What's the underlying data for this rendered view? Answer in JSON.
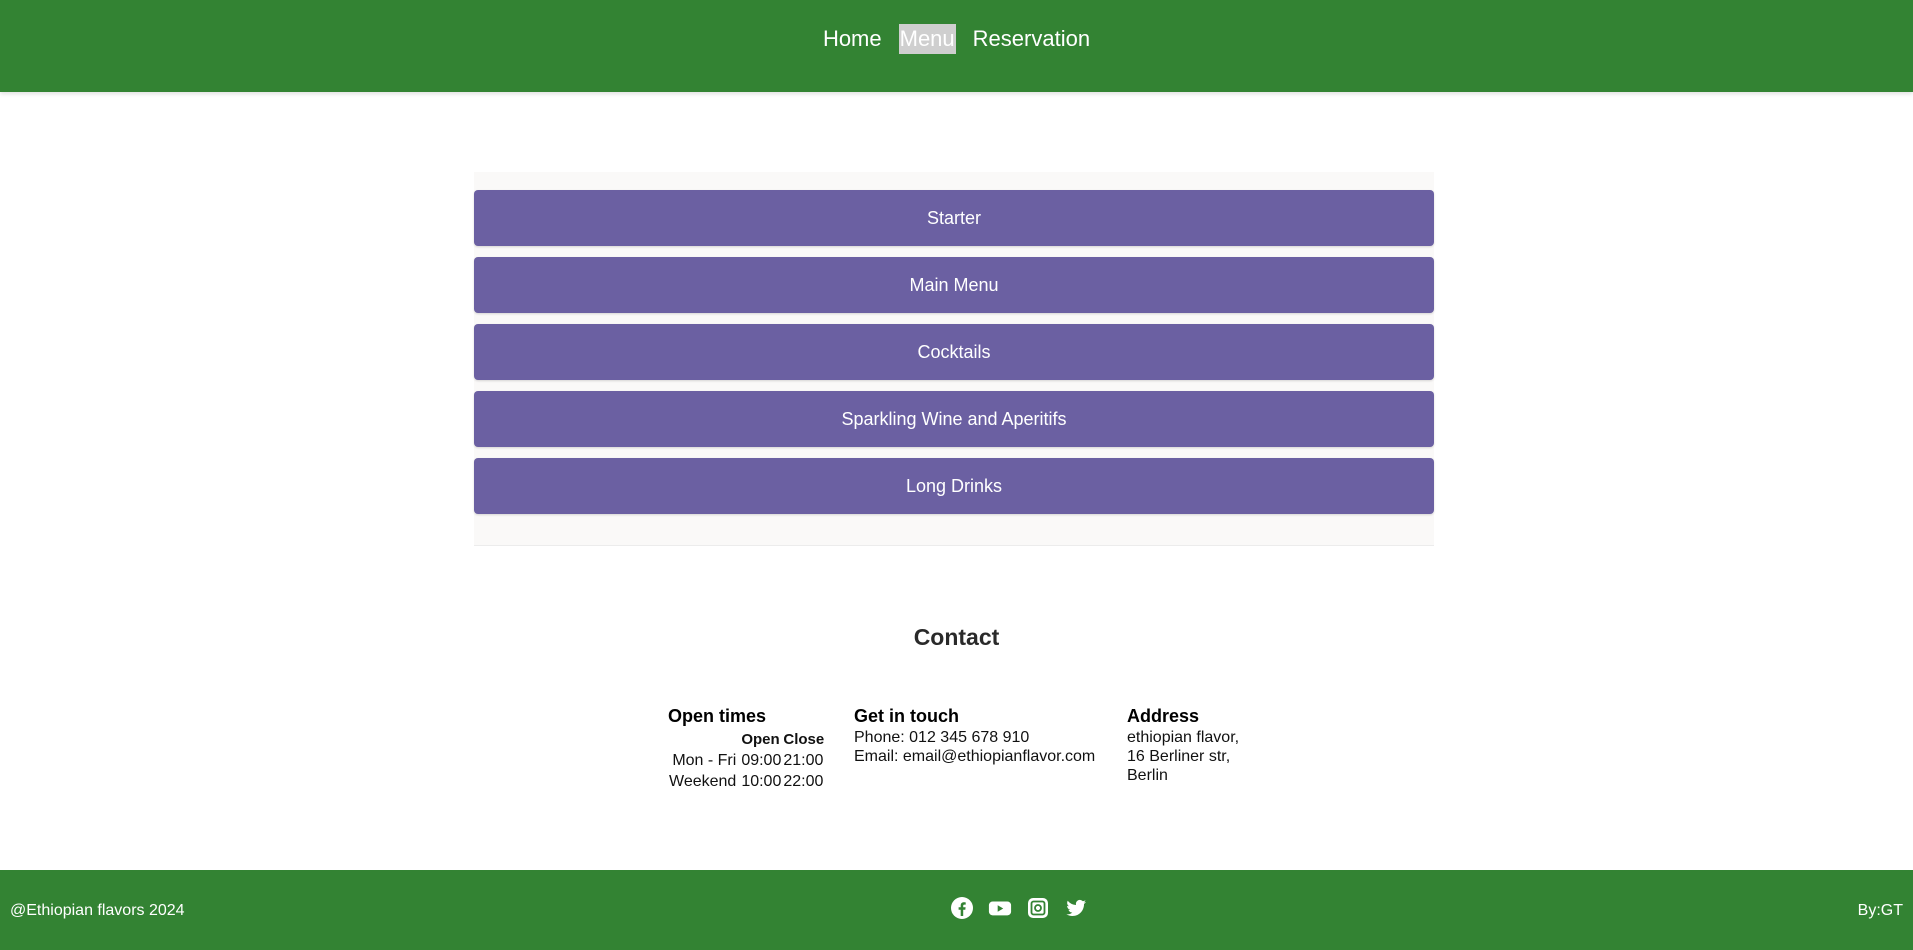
{
  "nav": {
    "items": [
      {
        "label": "Home"
      },
      {
        "label": "Menu"
      },
      {
        "label": "Reservation"
      }
    ]
  },
  "menu": {
    "categories": [
      {
        "label": "Starter"
      },
      {
        "label": "Main Menu"
      },
      {
        "label": "Cocktails"
      },
      {
        "label": "Sparkling Wine and Aperitifs"
      },
      {
        "label": "Long Drinks"
      }
    ]
  },
  "contact": {
    "title": "Contact",
    "open_times": {
      "heading": "Open times",
      "col_open": "Open",
      "col_close": "Close",
      "rows": [
        {
          "day": "Mon - Fri",
          "open": "09:00",
          "close": "21:00"
        },
        {
          "day": "Weekend",
          "open": "10:00",
          "close": "22:00"
        }
      ]
    },
    "get_in_touch": {
      "heading": "Get in touch",
      "phone": "Phone: 012 345 678 910",
      "email": "Email: email@ethiopianflavor.com"
    },
    "address": {
      "heading": "Address",
      "line1": "ethiopian flavor,",
      "line2": "16 Berliner str,",
      "line3": "Berlin"
    }
  },
  "footer": {
    "copyright": "@Ethiopian flavors 2024",
    "byline": "By:GT",
    "social": [
      "facebook-icon",
      "youtube-icon",
      "instagram-icon",
      "twitter-icon"
    ]
  },
  "colors": {
    "header_green": "#338333",
    "menu_purple": "#6b60a2",
    "active_highlight": "#cfcfcf"
  }
}
